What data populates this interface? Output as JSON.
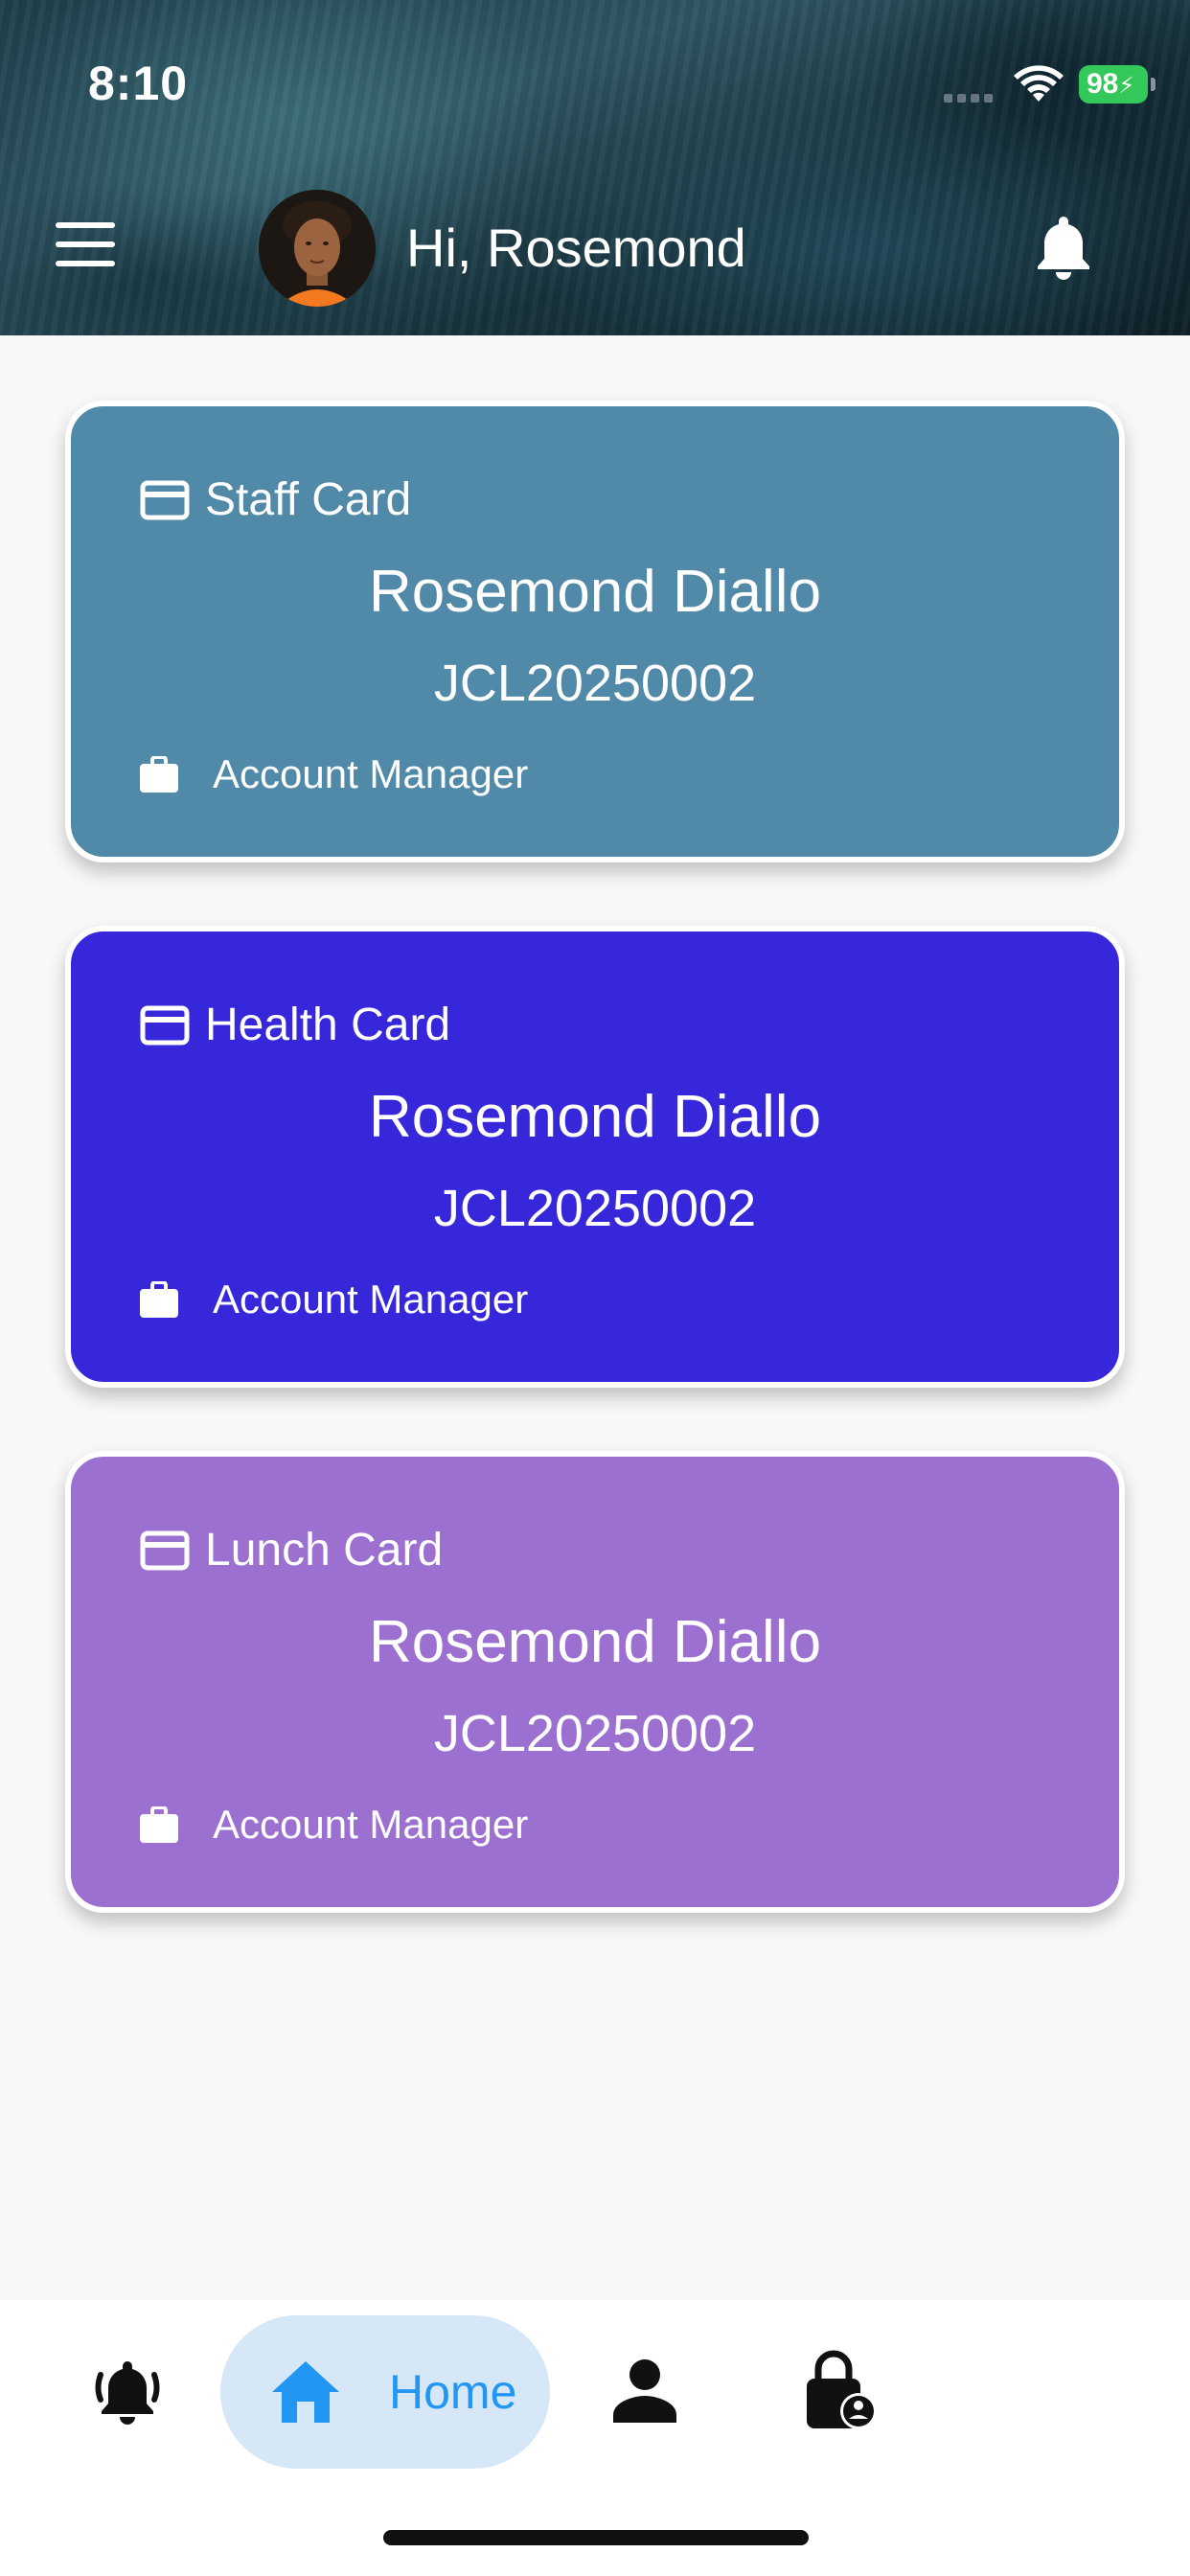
{
  "status_bar": {
    "time": "8:10",
    "battery": "98"
  },
  "header": {
    "greeting": "Hi, Rosemond",
    "menu_icon": "hamburger-menu-icon",
    "notification_icon": "bell-icon"
  },
  "cards": [
    {
      "type": "Staff Card",
      "name": "Rosemond Diallo",
      "id": "JCL20250002",
      "role": "Account Manager",
      "color": "#5189a9"
    },
    {
      "type": "Health Card",
      "name": "Rosemond Diallo",
      "id": "JCL20250002",
      "role": "Account Manager",
      "color": "#3727db"
    },
    {
      "type": "Lunch Card",
      "name": "Rosemond Diallo",
      "id": "JCL20250002",
      "role": "Account Manager",
      "color": "#9b70d0"
    }
  ],
  "bottom_nav": {
    "items": [
      {
        "icon": "notification-bell-icon"
      },
      {
        "icon": "home-icon",
        "label": "Home",
        "active": true
      },
      {
        "icon": "person-icon"
      },
      {
        "icon": "lock-person-icon"
      }
    ],
    "active_color": "#2196f3",
    "active_bg": "#d6e7f8"
  }
}
